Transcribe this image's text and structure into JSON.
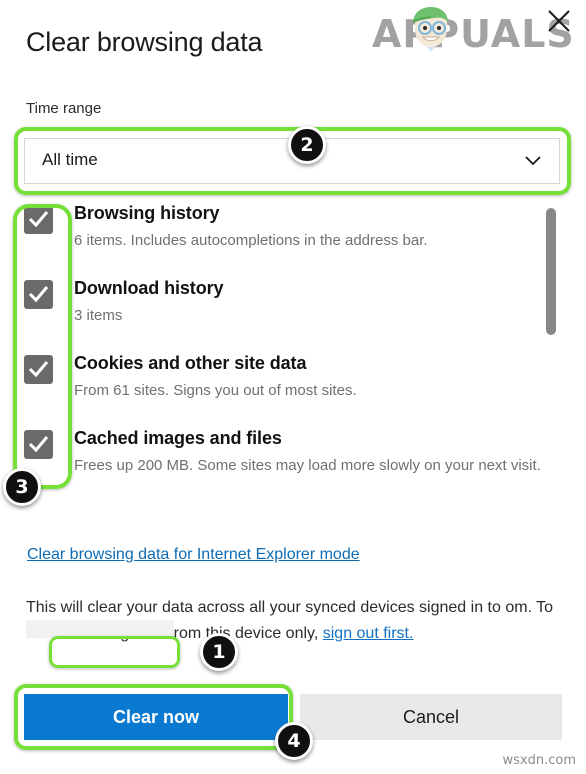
{
  "dialog": {
    "title": "Clear browsing data",
    "close_label": "Close",
    "close_icon": "close-x-icon"
  },
  "watermark": {
    "brand": "APPUALS",
    "brand_color": "#9b9b9b",
    "footer": "wsxdn.com"
  },
  "time_range": {
    "label": "Time range",
    "selected": "All time",
    "chevron_icon": "chevron-down-icon"
  },
  "options": [
    {
      "title": "Browsing history",
      "subtitle": "6 items. Includes autocompletions in the address bar.",
      "checked": true
    },
    {
      "title": "Download history",
      "subtitle": "3 items",
      "checked": true
    },
    {
      "title": "Cookies and other site data",
      "subtitle": "From 61 sites. Signs you out of most sites.",
      "checked": true
    },
    {
      "title": "Cached images and files",
      "subtitle": "Frees up 200 MB. Some sites may load more slowly on your next visit.",
      "checked": true
    }
  ],
  "ie_link": {
    "text": "Clear browsing data for Internet Explorer mode",
    "color": "#0d6cb4"
  },
  "sync_note": {
    "part1": "This will clear your data across all your synced devices signed in to",
    "redacted": "",
    "part2": "om. To clear browsing data from this device only,",
    "link": "sign out first.",
    "trailing": ""
  },
  "buttons": {
    "primary": "Clear now",
    "primary_color": "#0a79d0",
    "secondary": "Cancel",
    "secondary_color": "#e8e8e8"
  },
  "callouts": {
    "highlight_color": "#76e039",
    "badges": [
      "1",
      "2",
      "3",
      "4"
    ]
  }
}
